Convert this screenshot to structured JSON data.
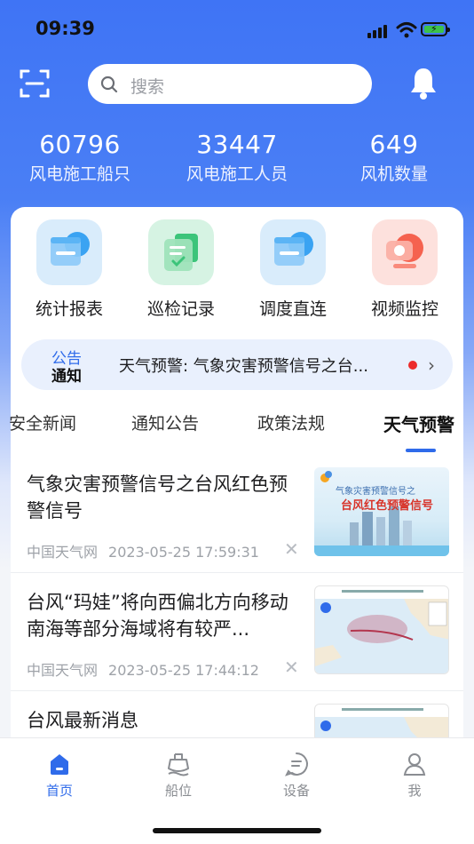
{
  "status_bar": {
    "time": "09:39"
  },
  "header": {
    "search_placeholder": "搜索"
  },
  "stats": [
    {
      "value": "60796",
      "label": "风电施工船只"
    },
    {
      "value": "33447",
      "label": "风电施工人员"
    },
    {
      "value": "649",
      "label": "风机数量"
    }
  ],
  "quick_actions": [
    {
      "label": "统计报表",
      "icon": "report-icon"
    },
    {
      "label": "巡检记录",
      "icon": "inspection-icon"
    },
    {
      "label": "调度直连",
      "icon": "dispatch-icon"
    },
    {
      "label": "视频监控",
      "icon": "camera-icon"
    }
  ],
  "notice": {
    "tag_line1": "公告",
    "tag_line2": "通知",
    "text": "天气预警: 气象灾害预警信号之台..."
  },
  "tabs": [
    {
      "label": "安全新闻"
    },
    {
      "label": "通知公告"
    },
    {
      "label": "政策法规"
    },
    {
      "label": "天气预警",
      "active": true
    }
  ],
  "news": [
    {
      "title": "气象灾害预警信号之台风红色预警信号",
      "source": "中国天气网",
      "date": "2023-05-25 17:59:31",
      "thumb_title_line1": "气象灾害预警信号之",
      "thumb_title_line2": "台风红色预警信号"
    },
    {
      "title": "台风“玛娃”将向西偏北方向移动 南海等部分海域将有较严...",
      "source": "中国天气网",
      "date": "2023-05-25 17:44:12"
    },
    {
      "title": "台风最新消息"
    }
  ],
  "tabbar": [
    {
      "label": "首页",
      "active": true
    },
    {
      "label": "船位"
    },
    {
      "label": "设备"
    },
    {
      "label": "我"
    }
  ],
  "colors": {
    "accent": "#2f6bea",
    "header_blue": "#3f74f5",
    "alert_red": "#ec2b2b"
  }
}
